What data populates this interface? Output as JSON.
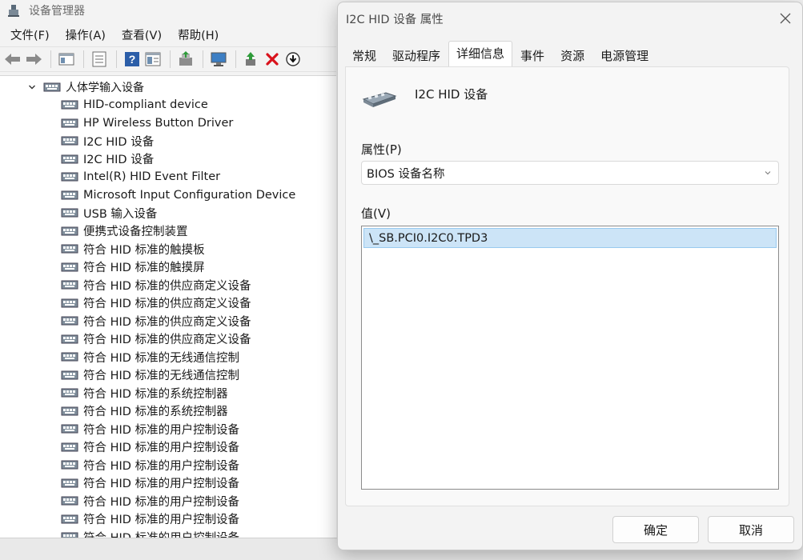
{
  "device_manager": {
    "title": "设备管理器",
    "menu": [
      "文件(F)",
      "操作(A)",
      "查看(V)",
      "帮助(H)"
    ],
    "toolbar_icons": [
      "back-arrow-icon",
      "forward-arrow-icon",
      "show-hide-icon",
      "properties-icon",
      "help-icon",
      "view-icon",
      "update-driver-icon",
      "scan-hardware-icon",
      "enable-device-icon",
      "uninstall-icon",
      "disable-device-icon"
    ],
    "tree": {
      "category": "人体学输入设备",
      "items": [
        "HID-compliant device",
        "HP Wireless Button Driver",
        "I2C HID 设备",
        "I2C HID 设备",
        "Intel(R) HID Event Filter",
        "Microsoft Input Configuration Device",
        "USB 输入设备",
        "便携式设备控制装置",
        "符合 HID 标准的触摸板",
        "符合 HID 标准的触摸屏",
        "符合 HID 标准的供应商定义设备",
        "符合 HID 标准的供应商定义设备",
        "符合 HID 标准的供应商定义设备",
        "符合 HID 标准的供应商定义设备",
        "符合 HID 标准的无线通信控制",
        "符合 HID 标准的无线通信控制",
        "符合 HID 标准的系统控制器",
        "符合 HID 标准的系统控制器",
        "符合 HID 标准的用户控制设备",
        "符合 HID 标准的用户控制设备",
        "符合 HID 标准的用户控制设备",
        "符合 HID 标准的用户控制设备",
        "符合 HID 标准的用户控制设备",
        "符合 HID 标准的用户控制设备",
        "符合 HID 标准的用户控制设备"
      ]
    }
  },
  "dialog": {
    "title": "I2C HID 设备 属性",
    "tabs": [
      {
        "label": "常规",
        "active": false
      },
      {
        "label": "驱动程序",
        "active": false
      },
      {
        "label": "详细信息",
        "active": true
      },
      {
        "label": "事件",
        "active": false
      },
      {
        "label": "资源",
        "active": false
      },
      {
        "label": "电源管理",
        "active": false
      }
    ],
    "device_name": "I2C HID 设备",
    "property_label": "属性(P)",
    "property_selected": "BIOS 设备名称",
    "value_label": "值(V)",
    "values": [
      "\\_SB.PCI0.I2C0.TPD3"
    ],
    "ok_label": "确定",
    "cancel_label": "取消"
  },
  "colors": {
    "selection_bg": "#cce4f7",
    "selection_border": "#99c9ef",
    "uninstall_red": "#d9121c",
    "update_green": "#2e9b3a"
  }
}
